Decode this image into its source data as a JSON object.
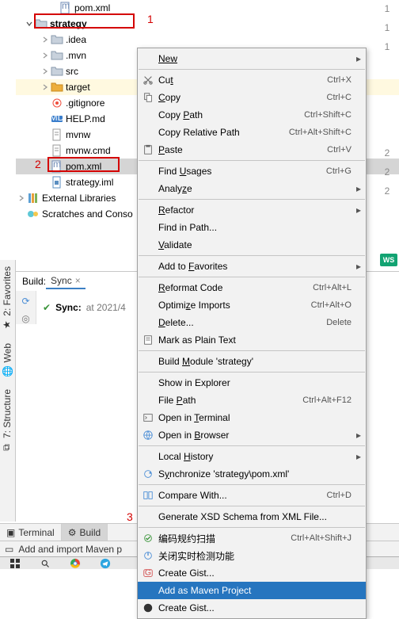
{
  "tree": {
    "upper_item": "pom.xml",
    "project": "strategy",
    "idea": ".idea",
    "mvn": ".mvn",
    "src": "src",
    "target": "target",
    "gitignore": ".gitignore",
    "helpmd": "HELP.md",
    "mvnw": "mvnw",
    "mvnwcmd": "mvnw.cmd",
    "pomxml": "pom.xml",
    "strategyiml": "strategy.iml",
    "external": "External Libraries",
    "scratches": "Scratches and Conso"
  },
  "annot": {
    "n1": "1",
    "n2": "2",
    "n3": "3"
  },
  "menu": {
    "new": "New",
    "cut": "Cut",
    "cut_u": "t",
    "cut_pre": "Cu",
    "cut_sc": "Ctrl+X",
    "copy": "Copy",
    "copy_u": "C",
    "copy_rest": "opy",
    "copy_sc": "Ctrl+C",
    "copypath": "Copy Path",
    "copypath_u": "P",
    "copypath_pre": "Copy ",
    "copypath_post": "ath",
    "copypath_sc": "Ctrl+Shift+C",
    "copyrel": "Copy Relative Path",
    "copyrel_sc": "Ctrl+Alt+Shift+C",
    "paste": "Paste",
    "paste_u": "P",
    "paste_rest": "aste",
    "paste_sc": "Ctrl+V",
    "findusages": "Find Usages",
    "findusages_u": "U",
    "findusages_pre": "Find ",
    "findusages_post": "sages",
    "findusages_sc": "Ctrl+G",
    "analyze": "Analyze",
    "analyze_u": "z",
    "analyze_pre": "Analy",
    "analyze_post": "e",
    "refactor": "Refactor",
    "refactor_u": "R",
    "refactor_rest": "efactor",
    "findinpath": "Find in Path...",
    "validate": "Validate",
    "validate_u": "V",
    "validate_rest": "alidate",
    "addfav": "Add to Favorites",
    "addfav_u": "F",
    "addfav_pre": "Add to ",
    "addfav_post": "avorites",
    "reformat": "Reformat Code",
    "reformat_u": "R",
    "reformat_rest": "eformat Code",
    "reformat_sc": "Ctrl+Alt+L",
    "optimize": "Optimize Imports",
    "optimize_u": "z",
    "optimize_pre": "Optimi",
    "optimize_post": "e Imports",
    "optimize_sc": "Ctrl+Alt+O",
    "delete": "Delete...",
    "delete_u": "D",
    "delete_rest": "elete...",
    "delete_sc": "Delete",
    "markplain": "Mark as Plain Text",
    "buildmodule": "Build Module 'strategy'",
    "buildmodule_u": "M",
    "buildmodule_pre": "Build ",
    "buildmodule_post": "odule 'strategy'",
    "showexpl": "Show in Explorer",
    "filepath": "File Path",
    "filepath_u": "P",
    "filepath_pre": "File ",
    "filepath_post": "ath",
    "filepath_sc": "Ctrl+Alt+F12",
    "openterm": "Open in Terminal",
    "openterm_u": "T",
    "openterm_pre": "Open in ",
    "openterm_post": "erminal",
    "openbrowser": "Open in Browser",
    "openbrowser_u": "B",
    "openbrowser_pre": "Open in ",
    "openbrowser_post": "rowser",
    "localhist": "Local History",
    "localhist_u": "H",
    "localhist_pre": "Local ",
    "localhist_post": "istory",
    "syncpom": "Synchronize 'strategy\\pom.xml'",
    "syncpom_u": "y",
    "syncpom_pre": "S",
    "syncpom_post": "nchronize 'strategy\\pom.xml'",
    "compare": "Compare With...",
    "compare_sc": "Ctrl+D",
    "genxsd": "Generate XSD Schema from XML File...",
    "scan": "编码规约扫描",
    "scan_sc": "Ctrl+Alt+Shift+J",
    "closert": "关闭实时检测功能",
    "gist1": "Create Gist...",
    "addmaven": "Add as Maven Project",
    "gist2": "Create Gist..."
  },
  "build": {
    "label": "Build:",
    "tab": "Sync",
    "sync": "Sync:",
    "date_prefix": "at 2021/4"
  },
  "vtabs": {
    "fav": "2: Favorites",
    "web": "Web",
    "struct": "7: Structure"
  },
  "twb": {
    "terminal": "Terminal",
    "build": "Build"
  },
  "status": {
    "msg": "Add and import Maven p"
  },
  "right_gutter": {
    "n1": "1",
    "n2": "1",
    "n3": "1",
    "n4": "2",
    "n5": "2",
    "n6": "2",
    "ws": "WS"
  }
}
